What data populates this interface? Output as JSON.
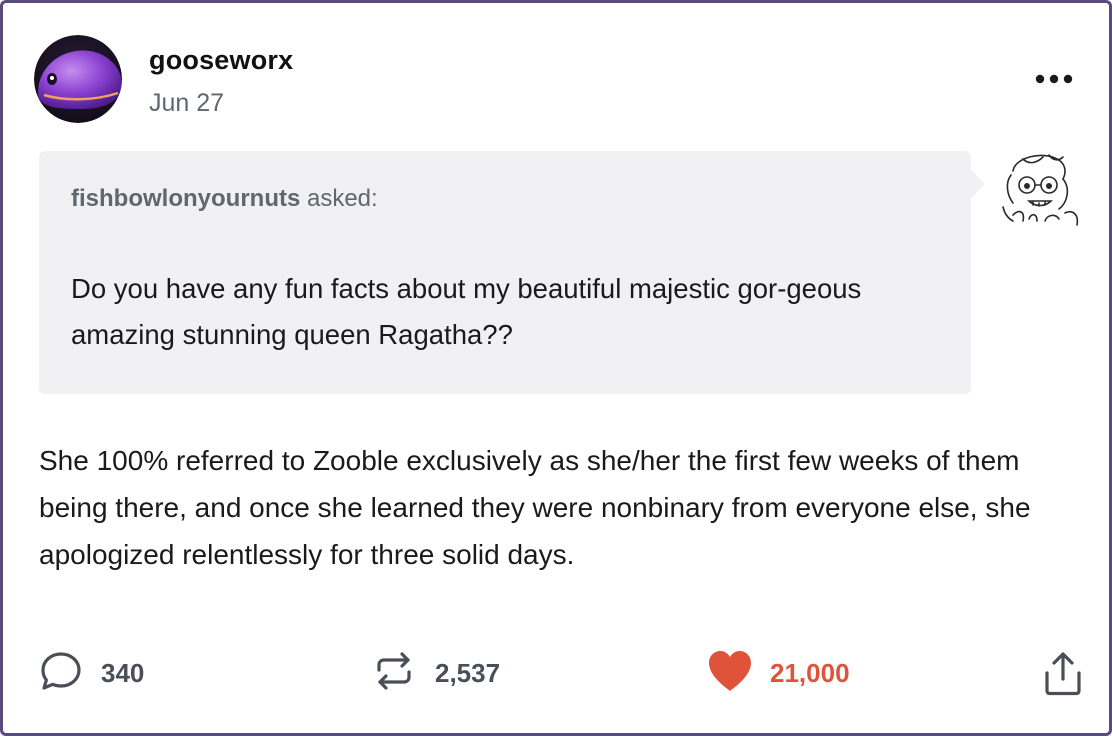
{
  "post": {
    "username": "gooseworx",
    "date": "Jun 27",
    "more_icon": "ellipsis-icon"
  },
  "ask": {
    "asker": "fishbowlonyournuts",
    "asked_label": " asked:",
    "question": "Do you have any fun facts about my beautiful majestic gor-geous amazing stunning queen Ragatha??"
  },
  "answer": {
    "text": "She 100% referred to Zooble exclusively as she/her the first few weeks of them being there, and once she learned they were nonbinary from everyone else, she apologized relentlessly for three solid days."
  },
  "actions": {
    "replies": "340",
    "reblogs": "2,537",
    "likes": "21,000"
  },
  "colors": {
    "frame_border": "#5b4a7e",
    "ask_background": "#f1f1f3",
    "muted_text": "#5f6770",
    "like_red": "#e0533b"
  }
}
